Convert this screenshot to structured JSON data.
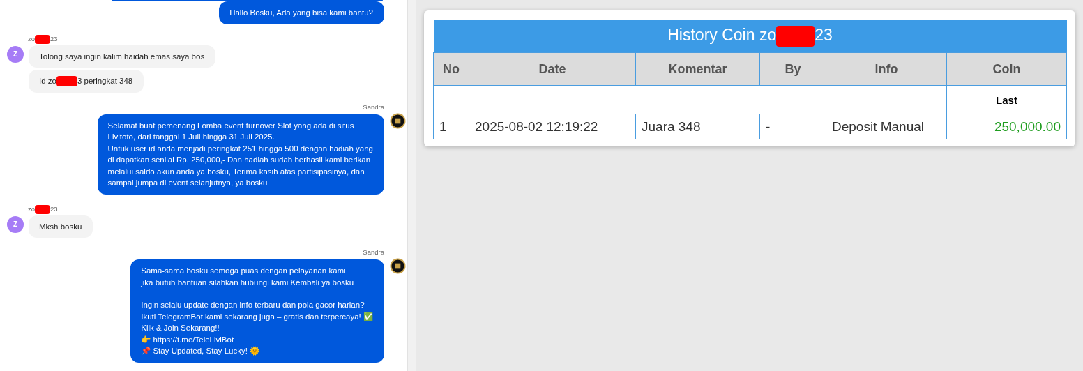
{
  "chat": {
    "messages": [
      {
        "kind": "outgoing",
        "avatar": false,
        "bubbles": [
          {
            "paragraphs": [
              [
                "Hallo Bosku, Ada yang bisa kami bantu?"
              ]
            ]
          }
        ]
      },
      {
        "kind": "incoming",
        "sender": [
          "zo",
          "23"
        ],
        "avatar_letter": "Z",
        "bubbles": [
          {
            "paragraphs": [
              [
                "Tolong saya ingin kalim haidah emas saya bos"
              ]
            ]
          },
          {
            "paragraphs": [
              [
                "Id zo",
                "3 peringkat 348"
              ]
            ]
          }
        ]
      },
      {
        "kind": "outgoing",
        "sender": "Sandra",
        "avatar": true,
        "bubbles": [
          {
            "paragraphs": [
              [
                "Selamat buat pemenang Lomba event turnover Slot yang ada di situs\nLivitoto, dari tanggal 1 Juli hingga 31 Juli 2025.\nUntuk user id anda menjadi peringkat 251 hingga 500 dengan hadiah yang\ndi dapatkan senilai Rp. 250,000,- Dan hadiah sudah berhasil kami berikan\nmelalui saldo akun anda ya bosku, Terima kasih atas partisipasinya, dan\nsampai jumpa di event selanjutnya, ya bosku"
              ]
            ]
          }
        ]
      },
      {
        "kind": "incoming",
        "sender": [
          "zo",
          "23"
        ],
        "avatar_letter": "Z",
        "bubbles": [
          {
            "paragraphs": [
              [
                "Mksh bosku"
              ]
            ]
          }
        ]
      },
      {
        "kind": "outgoing",
        "sender": "Sandra",
        "avatar": true,
        "bubbles": [
          {
            "paragraphs": [
              [
                "Sama-sama bosku semoga puas dengan pelayanan kami\njika butuh bantuan silahkan hubungi kami Kembali ya bosku"
              ],
              [
                "Ingin selalu update dengan info terbaru dan pola gacor harian?\nIkuti TelegramBot kami sekarang juga – gratis dan terpercaya! ✅\nKlik & Join Sekarang!!\n👉 https://t.me/TeleLiviBot\n📌 Stay Updated, Stay Lucky! 🌞"
              ]
            ]
          }
        ]
      }
    ]
  },
  "history": {
    "title": [
      "History Coin zo",
      "23"
    ],
    "columns": [
      "No",
      "Date",
      "Komentar",
      "By",
      "info",
      "Coin"
    ],
    "subheader": "Last",
    "rows": [
      {
        "no": "1",
        "date": "2025-08-02 12:19:22",
        "komentar": "Juara 348",
        "by": "-",
        "info": "Deposit Manual",
        "coin": "250,000.00"
      }
    ]
  }
}
